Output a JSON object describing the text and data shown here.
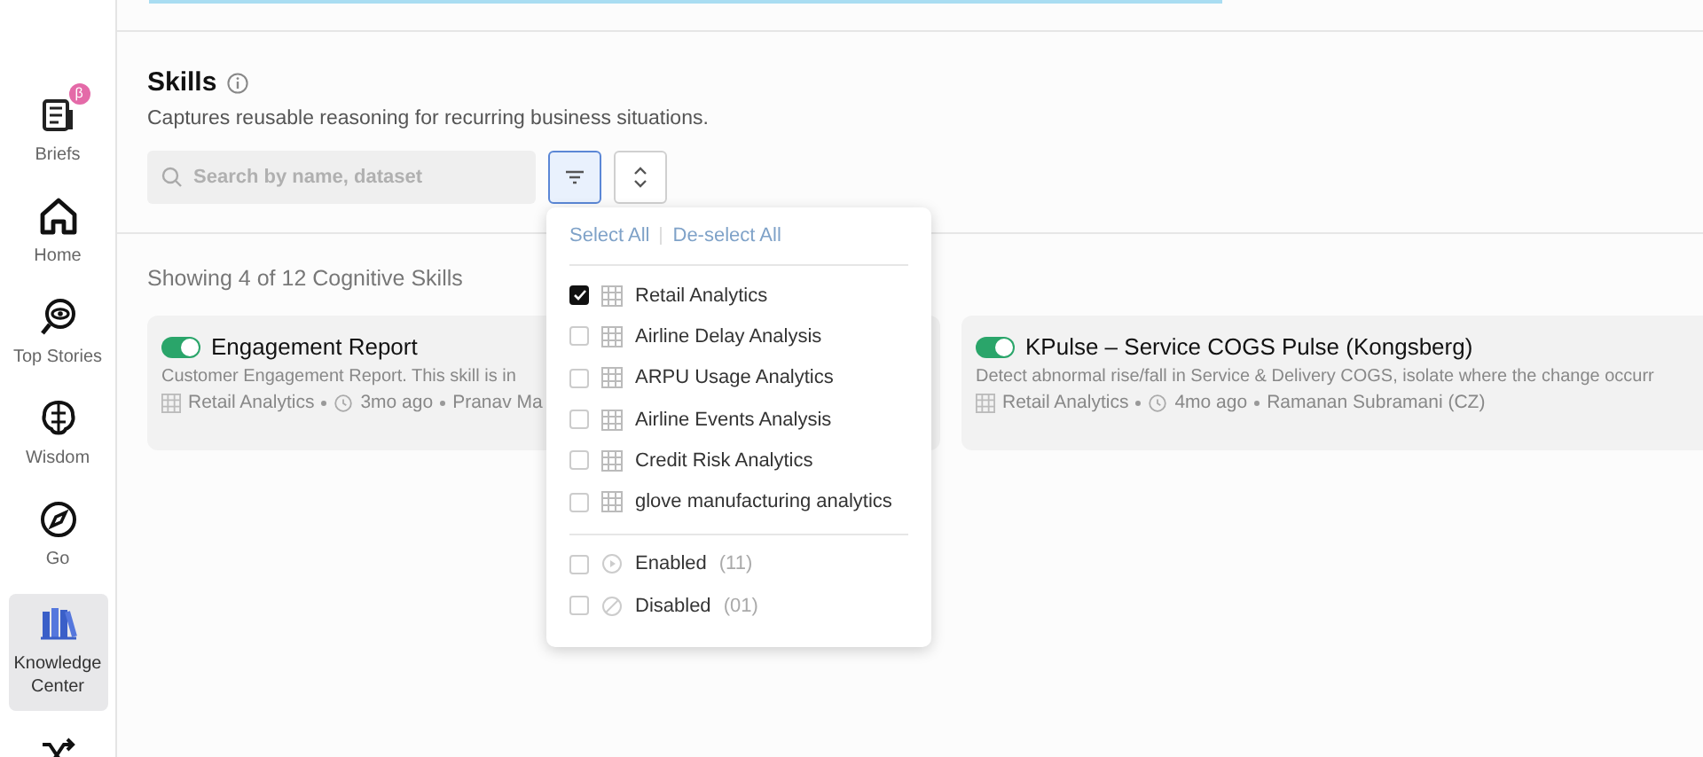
{
  "sidebar": {
    "items": [
      {
        "label": "Briefs",
        "badge": "β",
        "selected": false
      },
      {
        "label": "Home",
        "selected": false
      },
      {
        "label": "Top Stories",
        "selected": false
      },
      {
        "label": "Wisdom",
        "selected": false
      },
      {
        "label": "Go",
        "selected": false
      },
      {
        "label": "Knowledge Center",
        "selected": true
      },
      {
        "selected": false
      }
    ]
  },
  "section": {
    "title": "Skills",
    "subtitle": "Captures reusable reasoning for recurring business situations.",
    "search": {
      "placeholder": "Search by name, dataset"
    },
    "filter_button": {
      "selected": true
    },
    "sort_button": {
      "selected": false
    }
  },
  "summary": "Showing 4 of 12 Cognitive Skills",
  "cards": [
    {
      "enabled": true,
      "title": "Engagement Report",
      "description": "Customer Engagement Report. This skill is in",
      "dataset": "Retail Analytics",
      "age": "3mo ago",
      "author": "Pranav Ma"
    },
    {
      "enabled": true,
      "title": "KPulse – Service COGS Pulse (Kongsberg)",
      "description": "Detect abnormal rise/fall in Service & Delivery COGS, isolate where the change occurr",
      "dataset": "Retail Analytics",
      "age": "4mo ago",
      "author": "Ramanan Subramani (CZ)"
    }
  ],
  "filter_menu": {
    "select_all": "Select All",
    "deselect_all": "De-select All",
    "datasets": [
      {
        "label": "Retail Analytics",
        "checked": true
      },
      {
        "label": "Airline Delay Analysis",
        "checked": false
      },
      {
        "label": "ARPU Usage Analytics",
        "checked": false
      },
      {
        "label": "Airline Events Analysis",
        "checked": false
      },
      {
        "label": "Credit Risk Analytics",
        "checked": false
      },
      {
        "label": "glove manufacturing analytics",
        "checked": false
      }
    ],
    "statuses": [
      {
        "label": "Enabled",
        "count": "(11)",
        "kind": "enabled",
        "checked": false
      },
      {
        "label": "Disabled",
        "count": "(01)",
        "kind": "disabled",
        "checked": false
      }
    ]
  }
}
